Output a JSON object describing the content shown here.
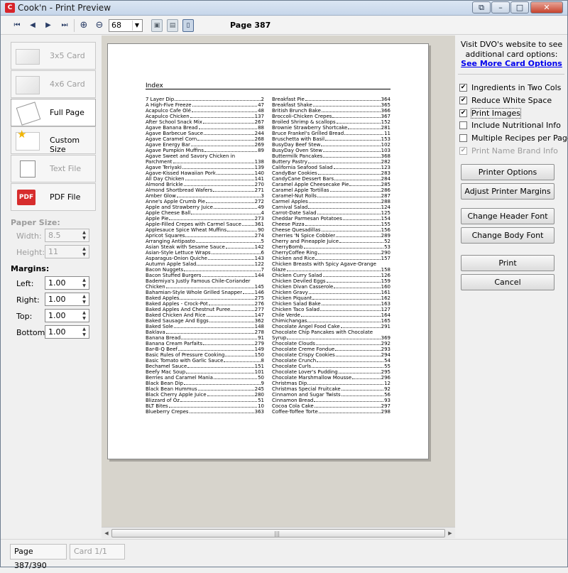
{
  "window": {
    "title": "Cook'n - Print Preview",
    "icon": "cookn-app-icon"
  },
  "toolbar": {
    "zoom_value": "68",
    "page_label": "Page 387",
    "icons": [
      "first-page-icon",
      "prev-page-icon",
      "next-page-icon",
      "last-page-icon",
      "zoom-in-icon",
      "zoom-out-icon",
      "chevron-down-icon",
      "single-page-icon",
      "two-page-icon",
      "fit-page-icon"
    ]
  },
  "formats": [
    {
      "label": "3x5 Card",
      "enabled": false
    },
    {
      "label": "4x6 Card",
      "enabled": false
    },
    {
      "label": "Full Page",
      "enabled": true,
      "selected": true
    },
    {
      "label": "Custom Size",
      "enabled": true
    },
    {
      "label": "Text File",
      "enabled": false
    },
    {
      "label": "PDF File",
      "enabled": true
    }
  ],
  "paper_size": {
    "heading": "Paper Size:",
    "width_label": "Width:",
    "width": "8.5",
    "height_label": "Height:",
    "height": "11"
  },
  "margins": {
    "heading": "Margins:",
    "left_label": "Left:",
    "left": "1.00",
    "right_label": "Right:",
    "right": "1.00",
    "top_label": "Top:",
    "top": "1.00",
    "bottom_label": "Bottom:",
    "bottom": "1.00"
  },
  "right_panel": {
    "visit_line1": "Visit DVO's website to see",
    "visit_line2": "additional card options:",
    "more_link": "See More Card Options",
    "options": [
      {
        "label": "Ingredients in Two Cols",
        "checked": true,
        "enabled": true
      },
      {
        "label": "Reduce White Space",
        "checked": true,
        "enabled": true
      },
      {
        "label": "Print Images",
        "checked": true,
        "enabled": true
      },
      {
        "label": "Include Nutritional Info",
        "checked": false,
        "enabled": true
      },
      {
        "label": "Multiple Recipes per Page",
        "checked": false,
        "enabled": true
      },
      {
        "label": "Print Name Brand Info",
        "checked": true,
        "enabled": false
      }
    ],
    "printer_options": "Printer Options",
    "adjust_margins": "Adjust Printer Margins",
    "change_header_font": "Change Header Font",
    "change_body_font": "Change Body Font",
    "print": "Print",
    "cancel": "Cancel"
  },
  "status": {
    "page": "Page 387/390",
    "card": "Card 1/1"
  },
  "document": {
    "title": "Index",
    "left_column": [
      [
        "7 Layer Dip",
        "2"
      ],
      [
        "A High-Five Freeze",
        "47"
      ],
      [
        "Acapulco Cafe Olé",
        "48"
      ],
      [
        "Acapulco Chicken",
        "137"
      ],
      [
        "After School Snack Mix",
        "267"
      ],
      [
        "Agave Banana Bread",
        "88"
      ],
      [
        "Agave Barbecue Sauce",
        "244"
      ],
      [
        "Agave Caramel Corn",
        "268"
      ],
      [
        "Agave Energy Bar",
        "269"
      ],
      [
        "Agave Pumpkin Muffins",
        "89"
      ],
      [
        "Agave Sweet and Savory Chicken in",
        ""
      ],
      [
        "Parchment",
        "138"
      ],
      [
        "Agave Teriyaki",
        "139"
      ],
      [
        "Agave-Kissed Hawaiian Pork",
        "140"
      ],
      [
        "All Day Chicken",
        "141"
      ],
      [
        "Almond Brickle",
        "270"
      ],
      [
        "Almond Shortbread Wafers",
        "271"
      ],
      [
        "Amber Glow",
        "3"
      ],
      [
        "Anne's Apple Crumb Pie",
        "272"
      ],
      [
        "Apple and Strawberry Juice",
        "49"
      ],
      [
        "Apple Cheese Ball",
        "4"
      ],
      [
        "Apple Pie",
        "273"
      ],
      [
        "Apple-Filled Crepes with Carmel Sauce",
        "361"
      ],
      [
        "Applesauce Spice Wheat Muffins",
        "90"
      ],
      [
        "Apricot Squares",
        "274"
      ],
      [
        "Arranging Antipasto",
        "5"
      ],
      [
        "Asian Steak with Sesame Sauce",
        "142"
      ],
      [
        "Asian-Style Lettuce Wraps",
        "6"
      ],
      [
        "Asparagus-Onion Quiche",
        "143"
      ],
      [
        "Autumn Apple Salad",
        "122"
      ],
      [
        "Bacon Nuggets",
        "7"
      ],
      [
        "Bacon Stuffed Burgers",
        "144"
      ],
      [
        "Bademiya's Justly Famous Chile-Coriander",
        ""
      ],
      [
        "Chicken",
        "145"
      ],
      [
        "Bahamian-Style Whole Grilled Snapper",
        "146"
      ],
      [
        "Baked Apples",
        "275"
      ],
      [
        "Baked Apples - Crock-Pot",
        "276"
      ],
      [
        "Baked Apples And Chestnut Puree",
        "277"
      ],
      [
        "Baked Chicken And Rice",
        "147"
      ],
      [
        "Baked Sausage And Eggs",
        "362"
      ],
      [
        "Baked Sole",
        "148"
      ],
      [
        "Baklava",
        "278"
      ],
      [
        "Banana Bread",
        "91"
      ],
      [
        "Banana Cream Parfaits",
        "279"
      ],
      [
        "Bar-B-Q Beef",
        "149"
      ],
      [
        "Basic Rules of Pressure Cooking",
        "150"
      ],
      [
        "Basic Tomato with Garlic Sauce",
        "8"
      ],
      [
        "Bechamel Sauce",
        "151"
      ],
      [
        "Beefy Mac Soup",
        "101"
      ],
      [
        "Berries and Caramel Mania",
        "50"
      ],
      [
        "Black Bean Dip",
        "9"
      ],
      [
        "Black Bean Hummus",
        "245"
      ],
      [
        "Black Cherry Apple Juice",
        "280"
      ],
      [
        "Blizzard of Oz",
        "51"
      ],
      [
        "BLT Bites",
        "10"
      ],
      [
        "Blueberry Crepes",
        "363"
      ]
    ],
    "right_column": [
      [
        "Breakfast Pie",
        "364"
      ],
      [
        "Breakfast Shake",
        "365"
      ],
      [
        "British Brunch Bake",
        "366"
      ],
      [
        "Broccoli-Chicken Crepes",
        "367"
      ],
      [
        "Broiled Shrimp & scallops",
        "152"
      ],
      [
        "Brownie Strawberry Shortcake",
        "281"
      ],
      [
        "Bruce Frankel's Grilled Bread",
        "11"
      ],
      [
        "Bruschetta with Basil",
        "153"
      ],
      [
        "BusyDay Beef Stew",
        "102"
      ],
      [
        "BusyDay Oven Stew",
        "103"
      ],
      [
        "Buttermilk Pancakes",
        "368"
      ],
      [
        "Buttery Pastry",
        "282"
      ],
      [
        "California Seafood Salad",
        "123"
      ],
      [
        "CandyBar Cookies",
        "283"
      ],
      [
        "CandyCane Dessert Bars",
        "284"
      ],
      [
        "Caramel Apple Cheesecake Pie",
        "285"
      ],
      [
        "Caramel Apple Tortillas",
        "286"
      ],
      [
        "Caramel-Nut Rolls",
        "287"
      ],
      [
        "Carmel Apples",
        "288"
      ],
      [
        "Carnival Salad",
        "124"
      ],
      [
        "Carrot-Date Salad",
        "125"
      ],
      [
        "Cheddar Parmesan Potatoes",
        "154"
      ],
      [
        "Cheese Pizza",
        "155"
      ],
      [
        "Cheese Quesadillas",
        "156"
      ],
      [
        "Cherries 'N Spice Cobbler",
        "289"
      ],
      [
        "Cherry and Pineapple Juice",
        "52"
      ],
      [
        "CherryBomb",
        "53"
      ],
      [
        "CherryCoffee Ring",
        "290"
      ],
      [
        "Chicken and Rice",
        "157"
      ],
      [
        "Chicken Breasts with Spicy Agave-Orange",
        ""
      ],
      [
        "Glaze",
        "158"
      ],
      [
        "Chicken Curry Salad",
        "126"
      ],
      [
        "Chicken Deviled Eggs",
        "159"
      ],
      [
        "Chicken Divan Casserole",
        "160"
      ],
      [
        "Chicken Gravy",
        "161"
      ],
      [
        "Chicken Piquant",
        "162"
      ],
      [
        "Chicken Salad Bake",
        "163"
      ],
      [
        "Chicken Taco Salad",
        "127"
      ],
      [
        "Chile Verde",
        "164"
      ],
      [
        "Chimichangas",
        "165"
      ],
      [
        "Chocolate Angel Food Cake",
        "291"
      ],
      [
        "Chocolate Chip Pancakes with Chocolate",
        ""
      ],
      [
        "Syrup",
        "369"
      ],
      [
        "Chocolate Clouds",
        "292"
      ],
      [
        "Chocolate Creme Fondue",
        "293"
      ],
      [
        "Chocolate Crispy Cookies",
        "294"
      ],
      [
        "Chocolate Crunch",
        "54"
      ],
      [
        "Chocolate Curls",
        "55"
      ],
      [
        "Chocolate Lover's Pudding",
        "295"
      ],
      [
        "Chocolate Marshmallow Mousse",
        "296"
      ],
      [
        "Christmas Dip",
        "12"
      ],
      [
        "Christmas Special Fruitcake",
        "92"
      ],
      [
        "Cinnamon and Sugar Twists",
        "56"
      ],
      [
        "Cinnamon Bread",
        "93"
      ],
      [
        "Cocoa Cola Cake",
        "297"
      ],
      [
        "Coffee-Toffee Torte",
        "298"
      ]
    ]
  }
}
